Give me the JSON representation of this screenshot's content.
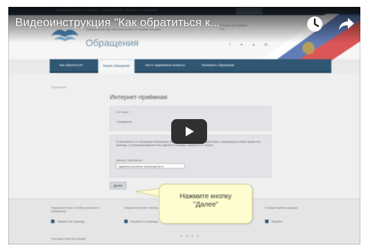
{
  "player": {
    "title": "Видеоинструкция \"Как обратиться к...",
    "icons": {
      "watch_later": "clock-icon",
      "share": "share-arrow-icon",
      "play": "play-icon"
    }
  },
  "site": {
    "topbar_links": "Президентский портал  ·  Сервисы  ·  Судебные органы  ·  Документы  ·  Обращения",
    "subtitle": "Официальный сайт Уполномоченного по правам человека",
    "title": "Обращения",
    "header_contacts": "Телефон для справок\nEng",
    "social": "f  ✦  ♦  ✉",
    "nav_tabs": [
      {
        "label": "Как обратиться?"
      },
      {
        "label": "Форма обращения"
      },
      {
        "label": "Часто задаваемые вопросы"
      },
      {
        "label": "Проверить обращение"
      }
    ],
    "breadcrumb": "Обращения",
    "form_title": "Интернет-приёмная",
    "form_label_1": "Кто пишет",
    "form_radio_1": "• Гражданин",
    "form_description": "В зависимости от специфики обращения, выберите вид действий (бездействия), нарушающего Ваши права или свободы, и органа/учреждения или судебного порядка, выберите из списка:",
    "form_label_2": "Вариант обращения",
    "form_select_value": "Административное производство ▾",
    "next_button": "Далее",
    "footer_cols": [
      {
        "text": "Нарушение прав и свобод человека и гражданина",
        "link": "Перейти на страницу"
      },
      {
        "text": "Нарушение прав и свобод военнослужащих",
        "link": "Перейти на страницу"
      },
      {
        "text": "Порядок приёма граждан",
        "link": "Перейти"
      }
    ],
    "dots": "• • • •",
    "bottom_text": "Президентская инструкция"
  },
  "callout": {
    "text": "Нажмите кнопку\n\"Далее\""
  },
  "colors": {
    "nav": "#2f5673",
    "callout": "#fdfdd0",
    "play_button": "#212121"
  }
}
